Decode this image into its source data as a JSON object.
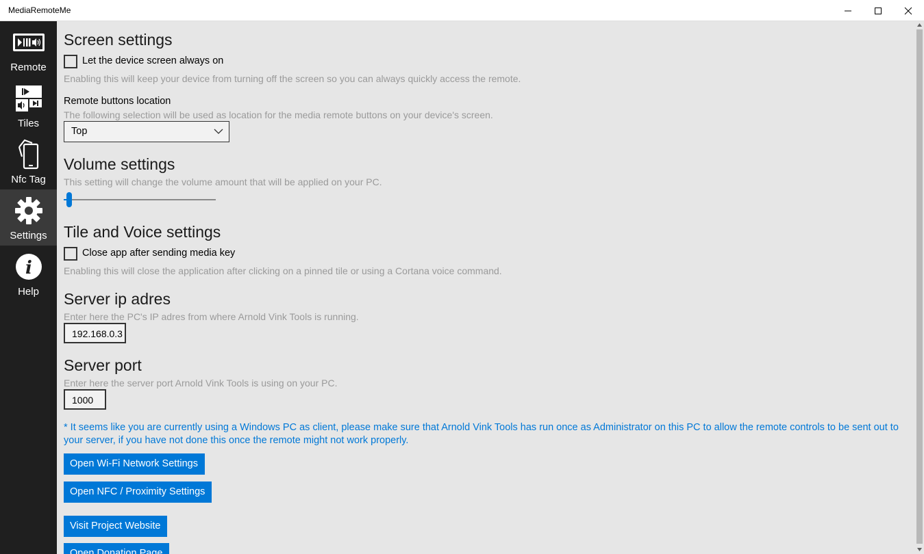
{
  "window": {
    "title": "MediaRemoteMe"
  },
  "sidebar": {
    "items": [
      {
        "label": "Remote",
        "icon": "remote-icon",
        "selected": false
      },
      {
        "label": "Tiles",
        "icon": "tiles-icon",
        "selected": false
      },
      {
        "label": "Nfc Tag",
        "icon": "nfc-tag-icon",
        "selected": false
      },
      {
        "label": "Settings",
        "icon": "gear-icon",
        "selected": true
      },
      {
        "label": "Help",
        "icon": "info-icon",
        "selected": false
      }
    ]
  },
  "screen_settings": {
    "heading": "Screen settings",
    "always_on_label": "Let the device screen always on",
    "always_on_checked": false,
    "always_on_desc": "Enabling this will keep your device from turning off the screen so you can always quickly access the remote.",
    "buttons_location_label": "Remote buttons location",
    "buttons_location_desc": "The following selection will be used as location for the media remote buttons on your device's screen.",
    "buttons_location_value": "Top"
  },
  "volume_settings": {
    "heading": "Volume settings",
    "desc": "This setting will change the volume amount that will be applied on your PC.",
    "slider_fraction": 0.02
  },
  "tile_voice_settings": {
    "heading": "Tile and Voice settings",
    "close_app_label": "Close app after sending media key",
    "close_app_checked": false,
    "close_app_desc": "Enabling this will close the application after clicking on a pinned tile or using a Cortana voice command."
  },
  "server_ip": {
    "heading": "Server ip adres",
    "desc": "Enter here the PC's IP adres from where Arnold Vink Tools is running.",
    "value": "192.168.0.3"
  },
  "server_port": {
    "heading": "Server port",
    "desc": "Enter here the server port Arnold Vink Tools is using on your PC.",
    "value": "1000"
  },
  "note": "* It seems like you are currently using a Windows PC as client, please make sure that Arnold Vink Tools has run once as Administrator on this PC to allow the remote controls to be sent out to your server, if you have not done this once the remote might not work properly.",
  "buttons": {
    "wifi": "Open Wi-Fi Network Settings",
    "nfc": "Open NFC / Proximity Settings",
    "website": "Visit Project Website",
    "donation": "Open Donation Page"
  },
  "colors": {
    "accent": "#0078d7",
    "sidebar_bg": "#1f1f1f",
    "content_bg": "#e6e6e6",
    "desc_text": "#9a9a9a"
  }
}
